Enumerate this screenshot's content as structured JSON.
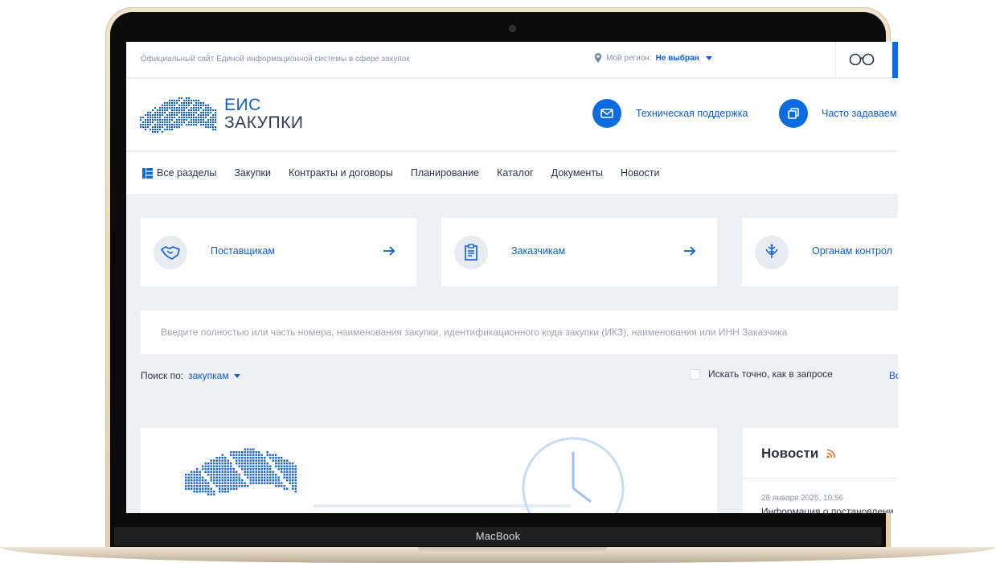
{
  "device": {
    "label": "MacBook"
  },
  "topbar": {
    "site_text": "Официальный сайт Единой информационной системы в сфере закупок",
    "region_label": "Мой регион:",
    "region_value": "Не выбран"
  },
  "header": {
    "logo_line1": "ЕИС",
    "logo_line2": "ЗАКУПКИ",
    "support_label": "Техническая поддержка",
    "faq_label": "Часто задаваем"
  },
  "nav": {
    "items": [
      "Все разделы",
      "Закупки",
      "Контракты и договоры",
      "Планирование",
      "Каталог",
      "Документы",
      "Новости"
    ]
  },
  "cards": [
    {
      "label": "Поставщикам",
      "icon": "handshake-icon"
    },
    {
      "label": "Заказчикам",
      "icon": "document-icon"
    },
    {
      "label": "Органам контрол",
      "icon": "emblem-icon"
    }
  ],
  "search": {
    "placeholder": "Введите полностью или часть номера, наименования закупки, идентификационного кода закупки (ИКЗ), наименования или ИНН Заказчика",
    "by_label": "Поиск по:",
    "by_value": "закупкам",
    "exact_label": "Искать точно, как в запросе",
    "more_label": "Во"
  },
  "news": {
    "title": "Новости",
    "date": "28 января 2025, 10:56",
    "item": "Информация о постановлени"
  },
  "colors": {
    "accent": "#0d6be0",
    "link": "#0d5bd7",
    "background": "#eef0f3"
  }
}
